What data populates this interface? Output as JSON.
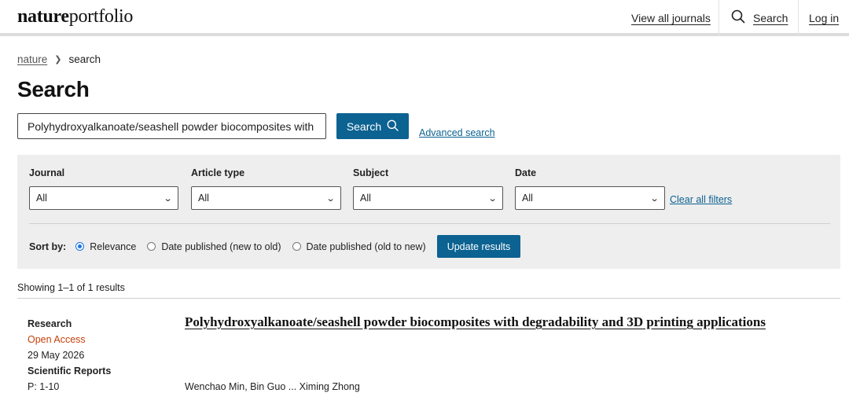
{
  "header": {
    "logo_bold": "nature",
    "logo_light": "portfolio",
    "view_all_journals": "View all journals",
    "search": "Search",
    "login": "Log in"
  },
  "breadcrumb": {
    "root": "nature",
    "current": "search"
  },
  "page_title": "Search",
  "search": {
    "value": "Polyhydroxyalkanoate/seashell powder biocomposites with",
    "button_label": "Search",
    "advanced_link": "Advanced search"
  },
  "filters": {
    "journal": {
      "label": "Journal",
      "value": "All"
    },
    "article_type": {
      "label": "Article type",
      "value": "All"
    },
    "subject": {
      "label": "Subject",
      "value": "All"
    },
    "date": {
      "label": "Date",
      "value": "All"
    },
    "clear_all": "Clear all filters"
  },
  "sort": {
    "label": "Sort by:",
    "options": [
      {
        "label": "Relevance",
        "selected": true
      },
      {
        "label": "Date published (new to old)",
        "selected": false
      },
      {
        "label": "Date published (old to new)",
        "selected": false
      }
    ],
    "update_button": "Update results"
  },
  "results_summary": "Showing 1–1 of 1 results",
  "results": [
    {
      "type": "Research",
      "access": "Open Access",
      "date": "29 May 2026",
      "journal": "Scientific Reports",
      "pages": "P: 1-10",
      "title": "Polyhydroxyalkanoate/seashell powder biocomposites with degradability and 3D printing applications",
      "authors": "Wenchao Min, Bin Guo ... Ximing Zhong"
    }
  ],
  "colors": {
    "primary": "#0c6291",
    "open_access": "#c4420c",
    "panel_bg": "#eeeeee"
  }
}
